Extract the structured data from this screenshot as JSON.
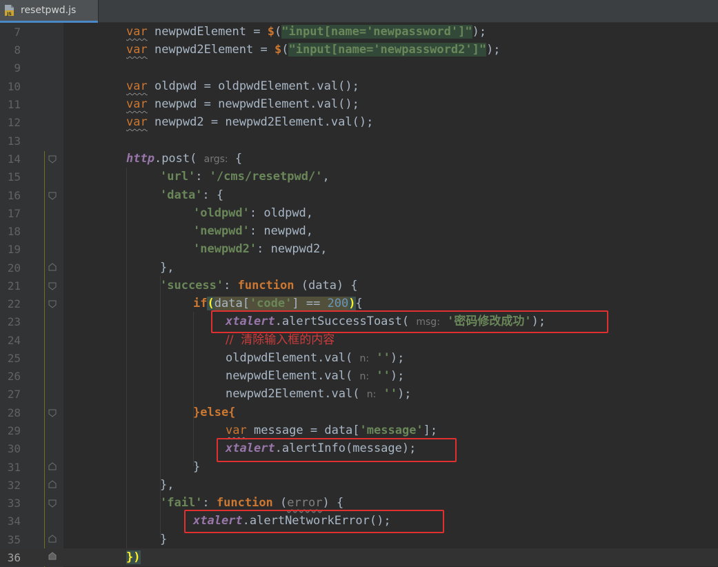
{
  "tab": {
    "label": "resetpwd.js",
    "icon": "javascript-file-icon"
  },
  "lines": [
    {
      "n": "7"
    },
    {
      "n": "8"
    },
    {
      "n": "9"
    },
    {
      "n": "10"
    },
    {
      "n": "11"
    },
    {
      "n": "12"
    },
    {
      "n": "13"
    },
    {
      "n": "14"
    },
    {
      "n": "15"
    },
    {
      "n": "16"
    },
    {
      "n": "17"
    },
    {
      "n": "18"
    },
    {
      "n": "19"
    },
    {
      "n": "20"
    },
    {
      "n": "21"
    },
    {
      "n": "22"
    },
    {
      "n": "23"
    },
    {
      "n": "24"
    },
    {
      "n": "25"
    },
    {
      "n": "26"
    },
    {
      "n": "27"
    },
    {
      "n": "28"
    },
    {
      "n": "29"
    },
    {
      "n": "30"
    },
    {
      "n": "31"
    },
    {
      "n": "32"
    },
    {
      "n": "33"
    },
    {
      "n": "34"
    },
    {
      "n": "35"
    },
    {
      "n": "36"
    }
  ],
  "code": {
    "var": "var",
    "newpwdElement": "newpwdElement",
    "newpwd2Element": "newpwd2Element",
    "oldpwdElement": "oldpwdElement",
    "eq": " = ",
    "dollar": "$",
    "sel_newpassword": "\"input[name='newpassword']\"",
    "sel_newpassword2": "\"input[name='newpassword2']\"",
    "oldpwd": "oldpwd",
    "newpwd": "newpwd",
    "newpwd2": "newpwd2",
    "val_call": ".val()",
    "http": "http",
    "post": ".post(",
    "hint_args": "args:",
    "key_url": "'url'",
    "url_value": "'/cms/resetpwd/'",
    "key_data": "'data'",
    "key_oldpwd": "'oldpwd'",
    "key_newpwd": "'newpwd'",
    "key_newpwd2": "'newpwd2'",
    "key_success": "'success'",
    "function": "function",
    "data_param": "(data)",
    "if_kw": "if",
    "data_ident": "data",
    "key_code": "'code'",
    "code_value": "200",
    "xtalert": "xtalert",
    "alertSuccessToast": ".alertSuccessToast(",
    "hint_msg": "msg:",
    "success_msg": "'密码修改成功'",
    "comment": "//  清除输入框的内容",
    "val_open": ".val(",
    "hint_n": "n:",
    "empty_str": "''",
    "else_kw": "}else{",
    "message": "message",
    "key_message": "'message'",
    "alertInfo": ".alertInfo(message);",
    "key_fail": "'fail'",
    "error_param": "error",
    "alertNetworkError": ".alertNetworkError();"
  }
}
